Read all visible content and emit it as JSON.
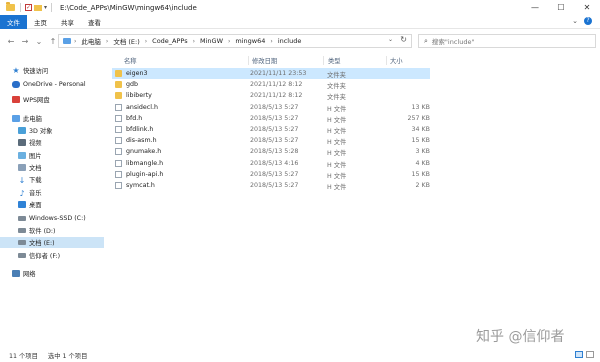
{
  "window": {
    "title": "E:\\Code_APPs\\MinGW\\mingw64\\include",
    "minimize": "—",
    "maximize": "☐",
    "close": "✕"
  },
  "ribbon": {
    "tabs": [
      {
        "label": "文件",
        "active": true
      },
      {
        "label": "主页",
        "active": false
      },
      {
        "label": "共享",
        "active": false
      },
      {
        "label": "查看",
        "active": false
      }
    ],
    "expand": "⌄",
    "help": "?"
  },
  "nav": {
    "back": "←",
    "forward": "→",
    "recent": "⌄",
    "up": "↑",
    "breadcrumbs": [
      "此电脑",
      "文档 (E:)",
      "Code_APPs",
      "MinGW",
      "mingw64",
      "include"
    ],
    "breadcrumb_sep": "›",
    "dropdown": "⌄",
    "refresh": "↻"
  },
  "search": {
    "icon": "⌕",
    "placeholder": "搜索\"include\""
  },
  "sidebar": {
    "items": [
      {
        "label": "快速访问",
        "icon": "star-icon",
        "glyph": "★",
        "cls": "star",
        "selected": false
      },
      {
        "label": "OneDrive - Personal",
        "icon": "cloud-icon",
        "glyph": "",
        "cls": "cloud",
        "selected": false
      },
      {
        "label": "WPS网盘",
        "icon": "wps-cloud-icon",
        "glyph": "",
        "cls": "wps",
        "selected": false
      },
      {
        "label": "此电脑",
        "icon": "computer-icon",
        "glyph": "",
        "cls": "pc",
        "selected": false
      },
      {
        "label": "3D 对象",
        "icon": "cube-icon",
        "glyph": "",
        "cls": "cube",
        "selected": false
      },
      {
        "label": "视频",
        "icon": "video-icon",
        "glyph": "",
        "cls": "video",
        "selected": false
      },
      {
        "label": "图片",
        "icon": "picture-icon",
        "glyph": "",
        "cls": "pic",
        "selected": false
      },
      {
        "label": "文档",
        "icon": "document-icon",
        "glyph": "",
        "cls": "doc",
        "selected": false
      },
      {
        "label": "下载",
        "icon": "download-icon",
        "glyph": "↓",
        "cls": "down",
        "selected": false
      },
      {
        "label": "音乐",
        "icon": "music-icon",
        "glyph": "♪",
        "cls": "music",
        "selected": false
      },
      {
        "label": "桌面",
        "icon": "desktop-icon",
        "glyph": "",
        "cls": "desk",
        "selected": false
      },
      {
        "label": "Windows-SSD (C:)",
        "icon": "drive-icon",
        "glyph": "",
        "cls": "drive",
        "selected": false
      },
      {
        "label": "软件 (D:)",
        "icon": "drive-icon",
        "glyph": "",
        "cls": "drive",
        "selected": false
      },
      {
        "label": "文档 (E:)",
        "icon": "drive-icon",
        "glyph": "",
        "cls": "drive",
        "selected": true
      },
      {
        "label": "信仰者 (F:)",
        "icon": "drive-icon",
        "glyph": "",
        "cls": "drive",
        "selected": false
      },
      {
        "label": "网络",
        "icon": "network-icon",
        "glyph": "",
        "cls": "net",
        "selected": false
      }
    ]
  },
  "list": {
    "columns": {
      "name": "名称",
      "date": "修改日期",
      "type": "类型",
      "size": "大小"
    },
    "files": [
      {
        "name": "eigen3",
        "date": "2021/11/11 23:53",
        "type": "文件夹",
        "size": "",
        "kind": "folder",
        "selected": true
      },
      {
        "name": "gdb",
        "date": "2021/11/12 8:12",
        "type": "文件夹",
        "size": "",
        "kind": "folder",
        "selected": false
      },
      {
        "name": "libiberty",
        "date": "2021/11/12 8:12",
        "type": "文件夹",
        "size": "",
        "kind": "folder",
        "selected": false
      },
      {
        "name": "ansidecl.h",
        "date": "2018/5/13 5:27",
        "type": "H 文件",
        "size": "13 KB",
        "kind": "file",
        "selected": false
      },
      {
        "name": "bfd.h",
        "date": "2018/5/13 5:27",
        "type": "H 文件",
        "size": "257 KB",
        "kind": "file",
        "selected": false
      },
      {
        "name": "bfdlink.h",
        "date": "2018/5/13 5:27",
        "type": "H 文件",
        "size": "34 KB",
        "kind": "file",
        "selected": false
      },
      {
        "name": "dis-asm.h",
        "date": "2018/5/13 5:27",
        "type": "H 文件",
        "size": "15 KB",
        "kind": "file",
        "selected": false
      },
      {
        "name": "gnumake.h",
        "date": "2018/5/13 5:28",
        "type": "H 文件",
        "size": "3 KB",
        "kind": "file",
        "selected": false
      },
      {
        "name": "libmangle.h",
        "date": "2018/5/13 4:16",
        "type": "H 文件",
        "size": "4 KB",
        "kind": "file",
        "selected": false
      },
      {
        "name": "plugin-api.h",
        "date": "2018/5/13 5:27",
        "type": "H 文件",
        "size": "15 KB",
        "kind": "file",
        "selected": false
      },
      {
        "name": "symcat.h",
        "date": "2018/5/13 5:27",
        "type": "H 文件",
        "size": "2 KB",
        "kind": "file",
        "selected": false
      }
    ]
  },
  "status": {
    "item_count": "11 个项目",
    "selected": "选中 1 个项目"
  },
  "watermark": "知乎 @信仰者"
}
